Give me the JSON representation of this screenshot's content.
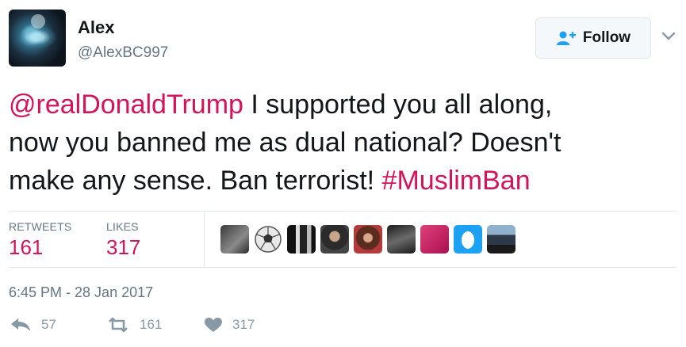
{
  "user": {
    "name": "Alex",
    "handle": "@AlexBC997"
  },
  "follow": {
    "label": "Follow",
    "icon": "add-user-icon"
  },
  "tweet": {
    "mention": "@realDonaldTrump",
    "body_line1": " I supported you all along,",
    "body_line2": "now you banned me as dual national? Doesn't",
    "body_line3": "make any sense. Ban terrorist! ",
    "hashtag": "#MuslimBan"
  },
  "stats": {
    "retweets_label": "RETWEETS",
    "retweets_value": "161",
    "likes_label": "LIKES",
    "likes_value": "317"
  },
  "likers": [
    "avatar-1",
    "avatar-2",
    "avatar-3",
    "avatar-4",
    "avatar-5",
    "avatar-6",
    "avatar-7",
    "avatar-8",
    "avatar-9"
  ],
  "timestamp": "6:45 PM - 28 Jan 2017",
  "actions": {
    "reply_count": "57",
    "retweet_count": "161",
    "like_count": "317"
  },
  "colors": {
    "accent": "#d4145a",
    "muted": "#657786",
    "text": "#14171a",
    "border": "#e1e8ed"
  }
}
